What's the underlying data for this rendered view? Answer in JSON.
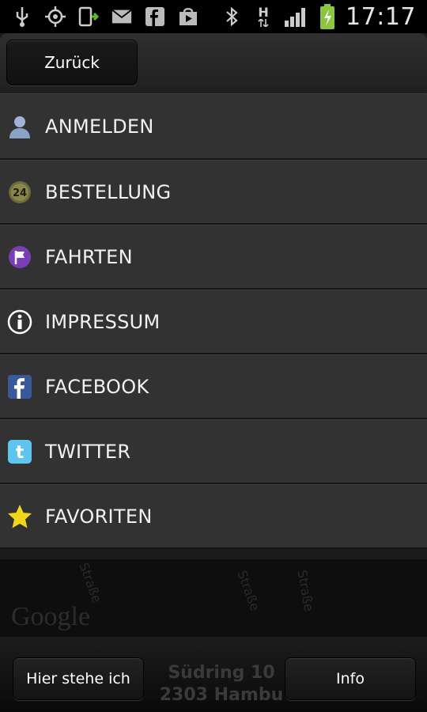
{
  "status_bar": {
    "time": "17:17",
    "icons_left": [
      "usb-icon",
      "gps-icon",
      "phone-sync-icon",
      "mail-icon",
      "facebook-icon",
      "play-store-icon"
    ],
    "icons_right": [
      "bluetooth-icon",
      "hspa-icon",
      "signal-icon",
      "battery-charging-icon"
    ],
    "network_label": "H"
  },
  "topbar": {
    "back_label": "Zurück"
  },
  "menu": {
    "items": [
      {
        "label": "ANMELDEN",
        "icon": "user-icon"
      },
      {
        "label": "BESTELLUNG",
        "icon": "clock-24-icon"
      },
      {
        "label": "FAHRTEN",
        "icon": "flag-icon"
      },
      {
        "label": "IMPRESSUM",
        "icon": "info-icon"
      },
      {
        "label": "FACEBOOK",
        "icon": "facebook-icon"
      },
      {
        "label": "TWITTER",
        "icon": "twitter-icon"
      },
      {
        "label": "FAVORITEN",
        "icon": "star-icon"
      }
    ]
  },
  "map": {
    "logo": "Google",
    "streets": [
      "Straße",
      "Straße",
      "Straße"
    ]
  },
  "bottombar": {
    "left_button": "Hier stehe ich",
    "right_button": "Info",
    "address_line1": "Südring 10",
    "address_line2": "2303 Hambu"
  },
  "colors": {
    "menu_bg": "#323232",
    "status_bg": "#000000",
    "star": "#f2d61e",
    "flag_purple": "#7a3fb5",
    "facebook_blue": "#3b5998",
    "twitter_blue": "#33b5e5"
  }
}
